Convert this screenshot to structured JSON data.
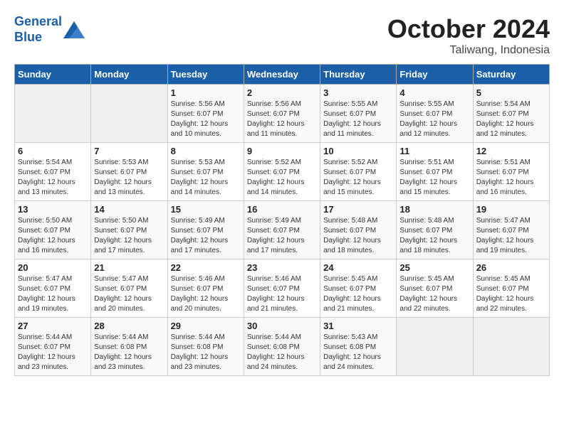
{
  "header": {
    "logo_line1": "General",
    "logo_line2": "Blue",
    "month": "October 2024",
    "location": "Taliwang, Indonesia"
  },
  "weekdays": [
    "Sunday",
    "Monday",
    "Tuesday",
    "Wednesday",
    "Thursday",
    "Friday",
    "Saturday"
  ],
  "weeks": [
    [
      {
        "day": "",
        "info": ""
      },
      {
        "day": "",
        "info": ""
      },
      {
        "day": "1",
        "info": "Sunrise: 5:56 AM\nSunset: 6:07 PM\nDaylight: 12 hours\nand 10 minutes."
      },
      {
        "day": "2",
        "info": "Sunrise: 5:56 AM\nSunset: 6:07 PM\nDaylight: 12 hours\nand 11 minutes."
      },
      {
        "day": "3",
        "info": "Sunrise: 5:55 AM\nSunset: 6:07 PM\nDaylight: 12 hours\nand 11 minutes."
      },
      {
        "day": "4",
        "info": "Sunrise: 5:55 AM\nSunset: 6:07 PM\nDaylight: 12 hours\nand 12 minutes."
      },
      {
        "day": "5",
        "info": "Sunrise: 5:54 AM\nSunset: 6:07 PM\nDaylight: 12 hours\nand 12 minutes."
      }
    ],
    [
      {
        "day": "6",
        "info": "Sunrise: 5:54 AM\nSunset: 6:07 PM\nDaylight: 12 hours\nand 13 minutes."
      },
      {
        "day": "7",
        "info": "Sunrise: 5:53 AM\nSunset: 6:07 PM\nDaylight: 12 hours\nand 13 minutes."
      },
      {
        "day": "8",
        "info": "Sunrise: 5:53 AM\nSunset: 6:07 PM\nDaylight: 12 hours\nand 14 minutes."
      },
      {
        "day": "9",
        "info": "Sunrise: 5:52 AM\nSunset: 6:07 PM\nDaylight: 12 hours\nand 14 minutes."
      },
      {
        "day": "10",
        "info": "Sunrise: 5:52 AM\nSunset: 6:07 PM\nDaylight: 12 hours\nand 15 minutes."
      },
      {
        "day": "11",
        "info": "Sunrise: 5:51 AM\nSunset: 6:07 PM\nDaylight: 12 hours\nand 15 minutes."
      },
      {
        "day": "12",
        "info": "Sunrise: 5:51 AM\nSunset: 6:07 PM\nDaylight: 12 hours\nand 16 minutes."
      }
    ],
    [
      {
        "day": "13",
        "info": "Sunrise: 5:50 AM\nSunset: 6:07 PM\nDaylight: 12 hours\nand 16 minutes."
      },
      {
        "day": "14",
        "info": "Sunrise: 5:50 AM\nSunset: 6:07 PM\nDaylight: 12 hours\nand 17 minutes."
      },
      {
        "day": "15",
        "info": "Sunrise: 5:49 AM\nSunset: 6:07 PM\nDaylight: 12 hours\nand 17 minutes."
      },
      {
        "day": "16",
        "info": "Sunrise: 5:49 AM\nSunset: 6:07 PM\nDaylight: 12 hours\nand 17 minutes."
      },
      {
        "day": "17",
        "info": "Sunrise: 5:48 AM\nSunset: 6:07 PM\nDaylight: 12 hours\nand 18 minutes."
      },
      {
        "day": "18",
        "info": "Sunrise: 5:48 AM\nSunset: 6:07 PM\nDaylight: 12 hours\nand 18 minutes."
      },
      {
        "day": "19",
        "info": "Sunrise: 5:47 AM\nSunset: 6:07 PM\nDaylight: 12 hours\nand 19 minutes."
      }
    ],
    [
      {
        "day": "20",
        "info": "Sunrise: 5:47 AM\nSunset: 6:07 PM\nDaylight: 12 hours\nand 19 minutes."
      },
      {
        "day": "21",
        "info": "Sunrise: 5:47 AM\nSunset: 6:07 PM\nDaylight: 12 hours\nand 20 minutes."
      },
      {
        "day": "22",
        "info": "Sunrise: 5:46 AM\nSunset: 6:07 PM\nDaylight: 12 hours\nand 20 minutes."
      },
      {
        "day": "23",
        "info": "Sunrise: 5:46 AM\nSunset: 6:07 PM\nDaylight: 12 hours\nand 21 minutes."
      },
      {
        "day": "24",
        "info": "Sunrise: 5:45 AM\nSunset: 6:07 PM\nDaylight: 12 hours\nand 21 minutes."
      },
      {
        "day": "25",
        "info": "Sunrise: 5:45 AM\nSunset: 6:07 PM\nDaylight: 12 hours\nand 22 minutes."
      },
      {
        "day": "26",
        "info": "Sunrise: 5:45 AM\nSunset: 6:07 PM\nDaylight: 12 hours\nand 22 minutes."
      }
    ],
    [
      {
        "day": "27",
        "info": "Sunrise: 5:44 AM\nSunset: 6:07 PM\nDaylight: 12 hours\nand 23 minutes."
      },
      {
        "day": "28",
        "info": "Sunrise: 5:44 AM\nSunset: 6:08 PM\nDaylight: 12 hours\nand 23 minutes."
      },
      {
        "day": "29",
        "info": "Sunrise: 5:44 AM\nSunset: 6:08 PM\nDaylight: 12 hours\nand 23 minutes."
      },
      {
        "day": "30",
        "info": "Sunrise: 5:44 AM\nSunset: 6:08 PM\nDaylight: 12 hours\nand 24 minutes."
      },
      {
        "day": "31",
        "info": "Sunrise: 5:43 AM\nSunset: 6:08 PM\nDaylight: 12 hours\nand 24 minutes."
      },
      {
        "day": "",
        "info": ""
      },
      {
        "day": "",
        "info": ""
      }
    ]
  ]
}
